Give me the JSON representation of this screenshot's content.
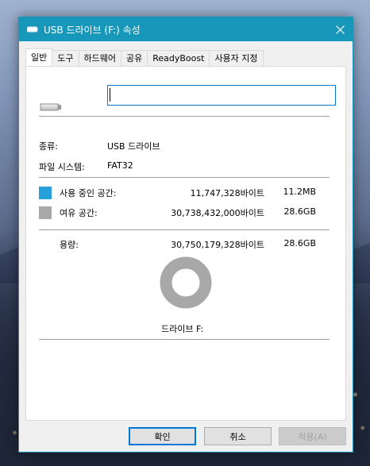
{
  "window": {
    "title": "USB 드라이브 (F:) 속성",
    "title_icon": "usb-drive-icon",
    "close_icon": "close-icon",
    "accent_color": "#1797b9"
  },
  "tabs": [
    {
      "label": "일반",
      "active": true
    },
    {
      "label": "도구",
      "active": false
    },
    {
      "label": "하드웨어",
      "active": false
    },
    {
      "label": "공유",
      "active": false
    },
    {
      "label": "ReadyBoost",
      "active": false
    },
    {
      "label": "사용자 지정",
      "active": false
    }
  ],
  "general": {
    "drive_icon": "usb-drive-icon",
    "name_value": "",
    "type_label": "종류:",
    "type_value": "USB 드라이브",
    "fs_label": "파일 시스템:",
    "fs_value": "FAT32",
    "used": {
      "label": "사용 중인 공간:",
      "bytes": "11,747,328바이트",
      "size": "11.2MB",
      "color": "#26a0da"
    },
    "free": {
      "label": "여유 공간:",
      "bytes": "30,738,432,000바이트",
      "size": "28.6GB",
      "color": "#a8a8a8"
    },
    "capacity": {
      "label": "용량:",
      "bytes": "30,750,179,328바이트",
      "size": "28.6GB"
    },
    "used_fraction": 0.00038,
    "drive_label": "드라이브 F:"
  },
  "buttons": {
    "ok": "확인",
    "cancel": "취소",
    "apply": "적용(A)"
  }
}
